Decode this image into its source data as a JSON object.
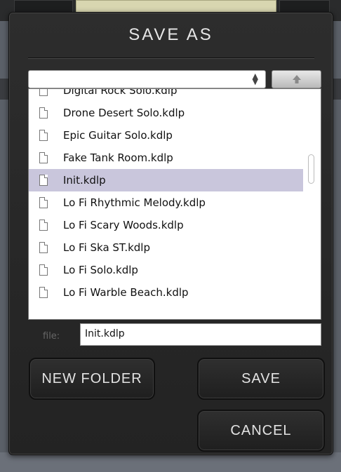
{
  "dialog": {
    "title": "SAVE AS",
    "path_select": {
      "value": ""
    },
    "files": [
      {
        "name": "Digital Rock Solo.kdlp",
        "selected": false
      },
      {
        "name": "Drone Desert Solo.kdlp",
        "selected": false
      },
      {
        "name": "Epic Guitar Solo.kdlp",
        "selected": false
      },
      {
        "name": "Fake Tank Room.kdlp",
        "selected": false
      },
      {
        "name": "Init.kdlp",
        "selected": true
      },
      {
        "name": "Lo Fi Rhythmic Melody.kdlp",
        "selected": false
      },
      {
        "name": "Lo Fi Scary Woods.kdlp",
        "selected": false
      },
      {
        "name": "Lo Fi Ska ST.kdlp",
        "selected": false
      },
      {
        "name": "Lo Fi Solo.kdlp",
        "selected": false
      },
      {
        "name": "Lo Fi Warble Beach.kdlp",
        "selected": false
      }
    ],
    "file_label": "file:",
    "file_value": "Init.kdlp",
    "buttons": {
      "new_folder": "NEW FOLDER",
      "save": "SAVE",
      "cancel": "CANCEL"
    },
    "icons": {
      "up": "arrow-up-icon",
      "file": "file-icon",
      "select": "updown-arrows-icon"
    }
  }
}
